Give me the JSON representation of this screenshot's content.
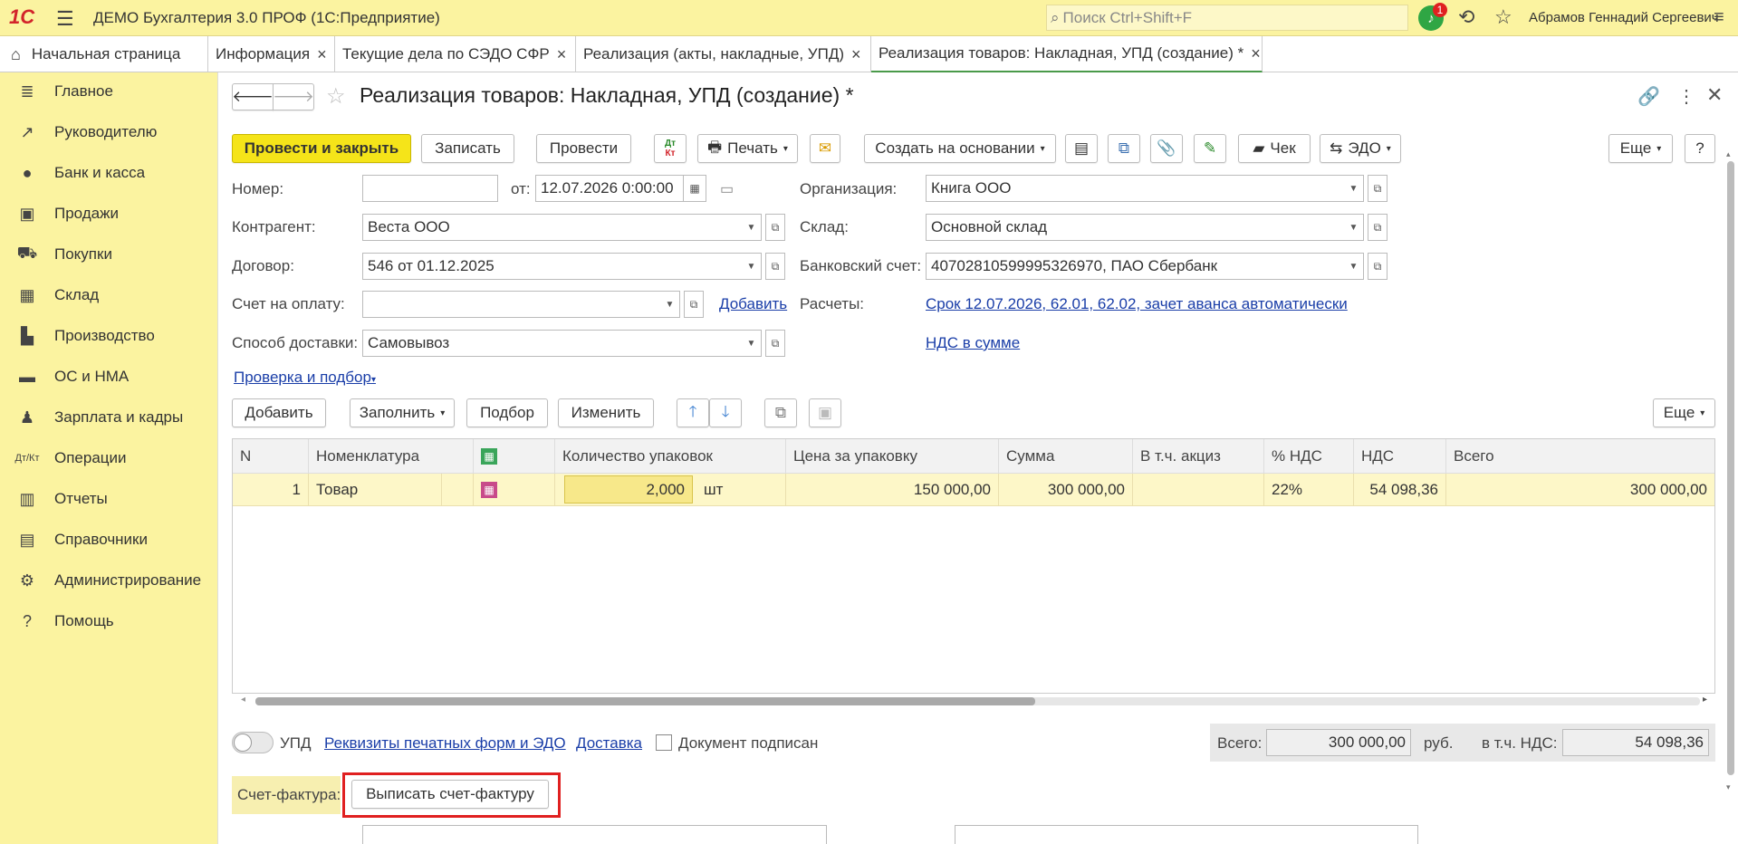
{
  "app": {
    "title": "ДЕМО Бухгалтерия 3.0 ПРОФ  (1С:Предприятие)",
    "logo": "1С",
    "search_placeholder": "Поиск Ctrl+Shift+F",
    "notification_count": "1",
    "user": "Абрамов Геннадий Сергеевич"
  },
  "tabs": {
    "home": "Начальная страница",
    "t1": "Информация",
    "t2": "Текущие дела по СЭДО СФР",
    "t3": "Реализация (акты, накладные, УПД)",
    "t4": "Реализация товаров: Накладная, УПД (создание) *"
  },
  "sidebar": [
    "Главное",
    "Руководителю",
    "Банк и касса",
    "Продажи",
    "Покупки",
    "Склад",
    "Производство",
    "ОС и НМА",
    "Зарплата и кадры",
    "Операции",
    "Отчеты",
    "Справочники",
    "Администрирование",
    "Помощь"
  ],
  "form": {
    "title": "Реализация товаров: Накладная, УПД (создание) *"
  },
  "toolbar": {
    "post_close": "Провести и закрыть",
    "save": "Записать",
    "post": "Провести",
    "dtkt_top": "Дт",
    "dtkt_bottom": "Кт",
    "print": "Печать",
    "create_based": "Создать на основании",
    "check": "Чек",
    "edo": "ЭДО",
    "more": "Еще",
    "help": "?"
  },
  "fields": {
    "number_label": "Номер:",
    "number_value": "",
    "date_label": "от:",
    "date_value": "12.07.2026  0:00:00",
    "org_label": "Организация:",
    "org_value": "Книга ООО",
    "counterparty_label": "Контрагент:",
    "counterparty_value": "Веста ООО",
    "warehouse_label": "Склад:",
    "warehouse_value": "Основной склад",
    "contract_label": "Договор:",
    "contract_value": "546 от 01.12.2025",
    "bank_label": "Банковский счет:",
    "bank_value": "40702810599995326970, ПАО Сбербанк",
    "invoice_label": "Счет на оплату:",
    "invoice_value": "",
    "add_link": "Добавить",
    "settlements_label": "Расчеты:",
    "settlements_link": "Срок 12.07.2026, 62.01, 62.02, зачет аванса автоматически",
    "delivery_label": "Способ доставки:",
    "delivery_value": "Самовывоз",
    "vat_link": "НДС в сумме",
    "check_link": "Проверка и подбор"
  },
  "table_toolbar": {
    "add": "Добавить",
    "fill": "Заполнить",
    "pick": "Подбор",
    "change": "Изменить",
    "more": "Еще"
  },
  "table": {
    "columns": [
      "N",
      "Номенклатура",
      "",
      "Количество упаковок",
      "Цена за упаковку",
      "Сумма",
      "В т.ч. акциз",
      "% НДС",
      "НДС",
      "Всего"
    ],
    "rows": [
      {
        "n": "1",
        "item": "Товар",
        "qty": "2,000",
        "unit": "шт",
        "price": "150 000,00",
        "sum": "300 000,00",
        "excise": "",
        "vat_rate": "22%",
        "vat": "54 098,36",
        "total": "300 000,00"
      }
    ]
  },
  "footer": {
    "upd_label": "УПД",
    "print_requisites_link": "Реквизиты печатных форм и ЭДО",
    "delivery_link": "Доставка",
    "signed_label": "Документ подписан",
    "total_label": "Всего:",
    "total_value": "300 000,00",
    "currency": "руб.",
    "vat_label": "в т.ч. НДС:",
    "vat_value": "54 098,36"
  },
  "invoice": {
    "label": "Счет-фактура:",
    "button": "Выписать счет-фактуру"
  },
  "colors": {
    "accent_yellow": "#fbf3a0",
    "primary_button": "#f5e419",
    "link": "#1a3ea8",
    "highlight_box": "#e02020"
  }
}
